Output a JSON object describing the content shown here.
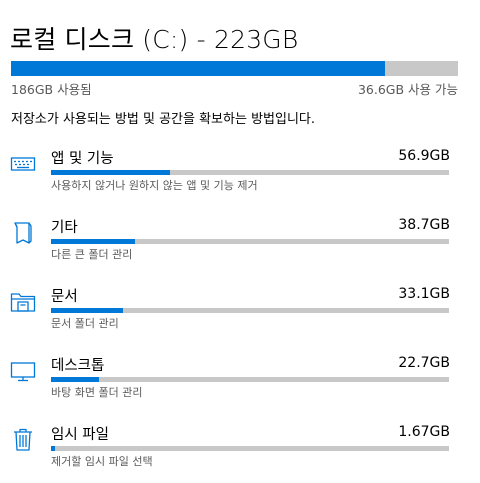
{
  "header": {
    "title": "로컬 디스크 (C:) - 223GB"
  },
  "usage": {
    "used_label": "186GB 사용됨",
    "free_label": "36.6GB 사용 가능",
    "used_fraction": 0.836,
    "accent_color": "#0078d7",
    "track_color": "#c8c8c8"
  },
  "description": "저장소가 사용되는 방법 및 공간을 확보하는 방법입니다.",
  "categories": [
    {
      "icon": "keyboard-icon",
      "name": "앱 및 기능",
      "size": "56.9GB",
      "fraction": 0.3,
      "subtext": "사용하지 않거나 원하지 않는 앱 및 기능 제거"
    },
    {
      "icon": "document-icon",
      "name": "기타",
      "size": "38.7GB",
      "fraction": 0.21,
      "subtext": "다른 큰 폴더 관리"
    },
    {
      "icon": "folder-icon",
      "name": "문서",
      "size": "33.1GB",
      "fraction": 0.18,
      "subtext": "문서 폴더 관리"
    },
    {
      "icon": "monitor-icon",
      "name": "데스크톱",
      "size": "22.7GB",
      "fraction": 0.12,
      "subtext": "바탕 화면 폴더 관리"
    },
    {
      "icon": "trash-icon",
      "name": "임시 파일",
      "size": "1.67GB",
      "fraction": 0.01,
      "subtext": "제거할 임시 파일 선택"
    }
  ]
}
